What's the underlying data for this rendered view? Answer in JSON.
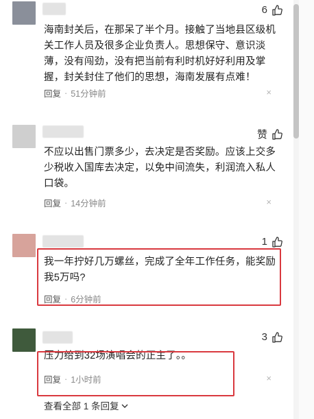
{
  "comments": [
    {
      "likes": "6",
      "text": "海南封关后，在那呆了半个月。接触了当地县区级机关工作人员及很多企业负责人。思想保守、意识淡薄，没有闯劲，没有把当前有利时机好好利用及掌握，封关封住了他们的思想，海南发展有点难！",
      "reply_label": "回复",
      "time": "51分钟前",
      "avatar_color": "#8a8f9a"
    },
    {
      "likes": "赞",
      "text": "不应以出售门票多少，去决定是否奖励。应该上交多少税收入国库去决定，以免中间流失，利润流入私人口袋。",
      "reply_label": "回复",
      "time": "14分钟前",
      "avatar_color": "#cfcfcf"
    },
    {
      "likes": "1",
      "text": "我一年拧好几万螺丝，完成了全年工作任务，能奖励我5万吗?",
      "reply_label": "回复",
      "time": "6分钟前",
      "avatar_color": "#d7a39b"
    },
    {
      "likes": "3",
      "text": "压力给到32场演唱会的正主了。。",
      "reply_label": "回复",
      "time": "1小时前",
      "avatar_color": "#3f5a3c"
    }
  ],
  "see_all": "查看全部 1 条回复",
  "dot": "·",
  "close_glyph": "×",
  "colors": {
    "highlight": "#d9383e",
    "scrollbar": "#c4c4c4"
  }
}
